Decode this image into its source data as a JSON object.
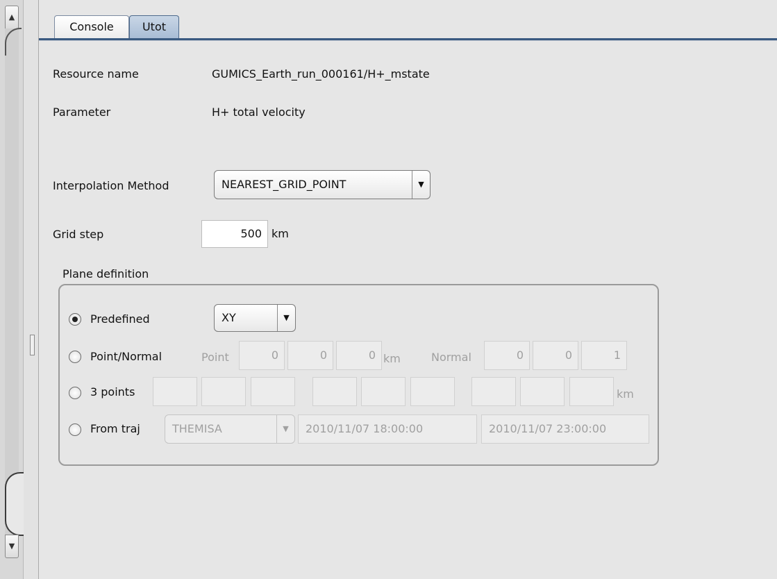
{
  "tabs": {
    "console": "Console",
    "utot": "Utot"
  },
  "resource": {
    "label": "Resource name",
    "value": "GUMICS_Earth_run_000161/H+_mstate"
  },
  "parameter": {
    "label": "Parameter",
    "value": "H+ total velocity"
  },
  "interpolation": {
    "label": "Interpolation Method",
    "selected": "NEAREST_GRID_POINT"
  },
  "grid_step": {
    "label": "Grid step",
    "value": "500",
    "unit": "km"
  },
  "plane": {
    "title": "Plane definition",
    "predefined": {
      "label": "Predefined",
      "selected": "XY",
      "checked": true
    },
    "point_normal": {
      "label": "Point/Normal",
      "point_label": "Point",
      "point_values": [
        "0",
        "0",
        "0"
      ],
      "point_unit": "km",
      "normal_label": "Normal",
      "normal_values": [
        "0",
        "0",
        "1"
      ]
    },
    "three_points": {
      "label": "3 points",
      "unit": "km"
    },
    "from_traj": {
      "label": "From traj",
      "spacecraft": "THEMISA",
      "start": "2010/11/07 18:00:00",
      "end": "2010/11/07 23:00:00"
    }
  },
  "icons": {
    "scroll_up": "▲",
    "scroll_down": "▼",
    "combo_arrow": "▼"
  },
  "colors": {
    "tab_active": "#b3c4d9",
    "tab_underline": "#3a5a80",
    "background": "#e6e6e6"
  }
}
